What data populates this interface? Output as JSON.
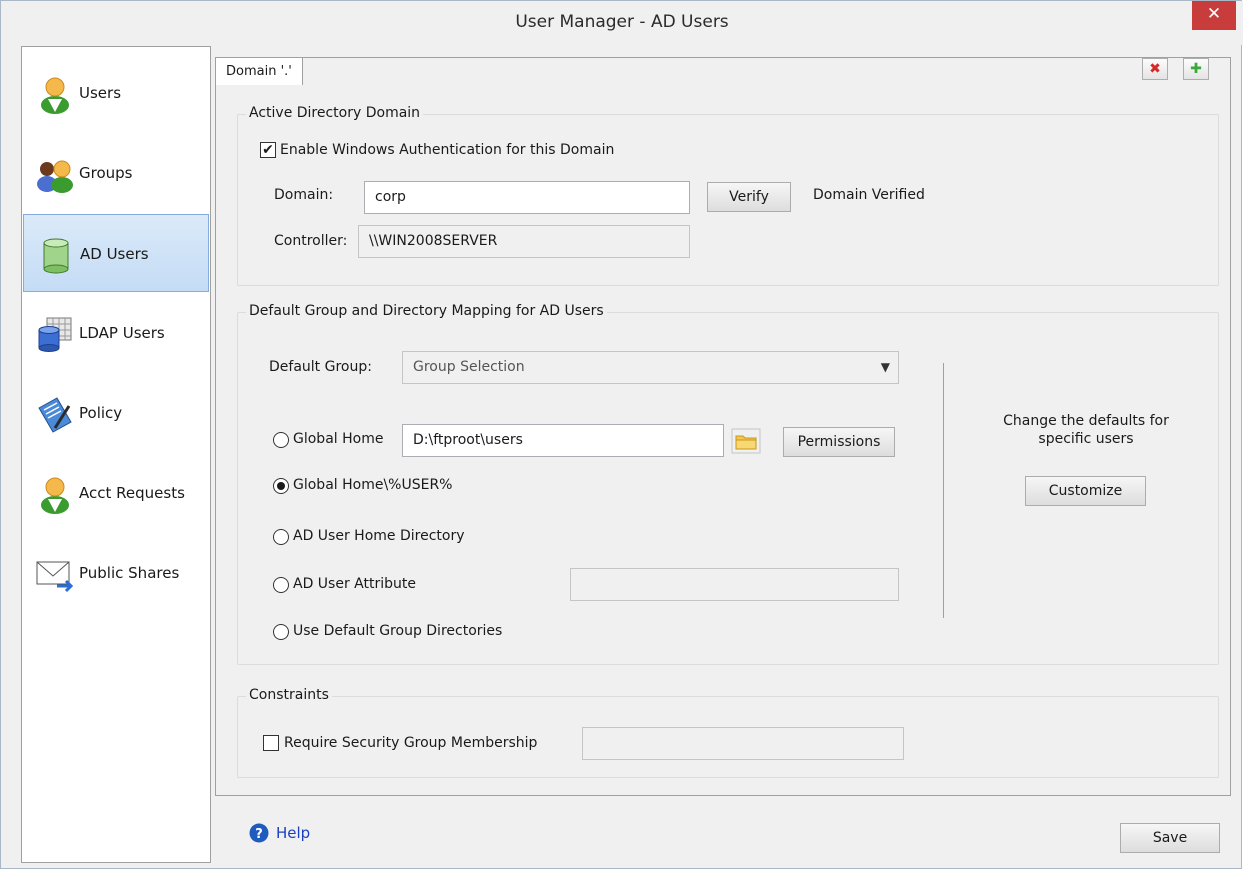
{
  "window": {
    "title": "User Manager - AD Users",
    "close_glyph": "✕"
  },
  "sidebar": {
    "items": [
      {
        "label": "Users",
        "icon": "user-icon"
      },
      {
        "label": "Groups",
        "icon": "groups-icon"
      },
      {
        "label": "AD Users",
        "icon": "ad-database-icon",
        "active": true
      },
      {
        "label": "LDAP Users",
        "icon": "ldap-database-icon"
      },
      {
        "label": "Policy",
        "icon": "policy-icon"
      },
      {
        "label": "Acct Requests",
        "icon": "account-request-icon"
      },
      {
        "label": "Public Shares",
        "icon": "public-shares-envelope-icon"
      }
    ]
  },
  "tab": {
    "label": "Domain '.'"
  },
  "toolbar": {
    "delete_glyph": "✖",
    "add_glyph": "✚"
  },
  "ad_domain": {
    "legend": "Active Directory Domain",
    "enable_label": "Enable Windows Authentication for this Domain",
    "enable_checked": true,
    "domain_label": "Domain:",
    "domain_value": "corp",
    "verify_label": "Verify",
    "verify_status": "Domain Verified",
    "controller_label": "Controller:",
    "controller_value": "\\\\WIN2008SERVER"
  },
  "mapping": {
    "legend": "Default Group and Directory Mapping for AD Users",
    "default_group_label": "Default Group:",
    "default_group_value": "Group Selection",
    "global_home_label": "Global Home",
    "global_home_value": "D:\\ftproot\\users",
    "permissions_label": "Permissions",
    "global_home_user_label": "Global Home\\%USER%",
    "ad_user_home_label": "AD User Home Directory",
    "ad_user_attribute_label": "AD User Attribute",
    "use_default_group_label": "Use Default Group Directories",
    "selected_option": "global_home_user",
    "customize_text_1": "Change the defaults for",
    "customize_text_2": "specific users",
    "customize_label": "Customize"
  },
  "constraints": {
    "legend": "Constraints",
    "require_label": "Require Security Group Membership",
    "require_checked": false
  },
  "footer": {
    "help_label": "Help",
    "save_label": "Save"
  },
  "colors": {
    "active_item": "#c4dcf5",
    "close_button": "#c83c3c",
    "help_link": "#1a3fbf"
  }
}
